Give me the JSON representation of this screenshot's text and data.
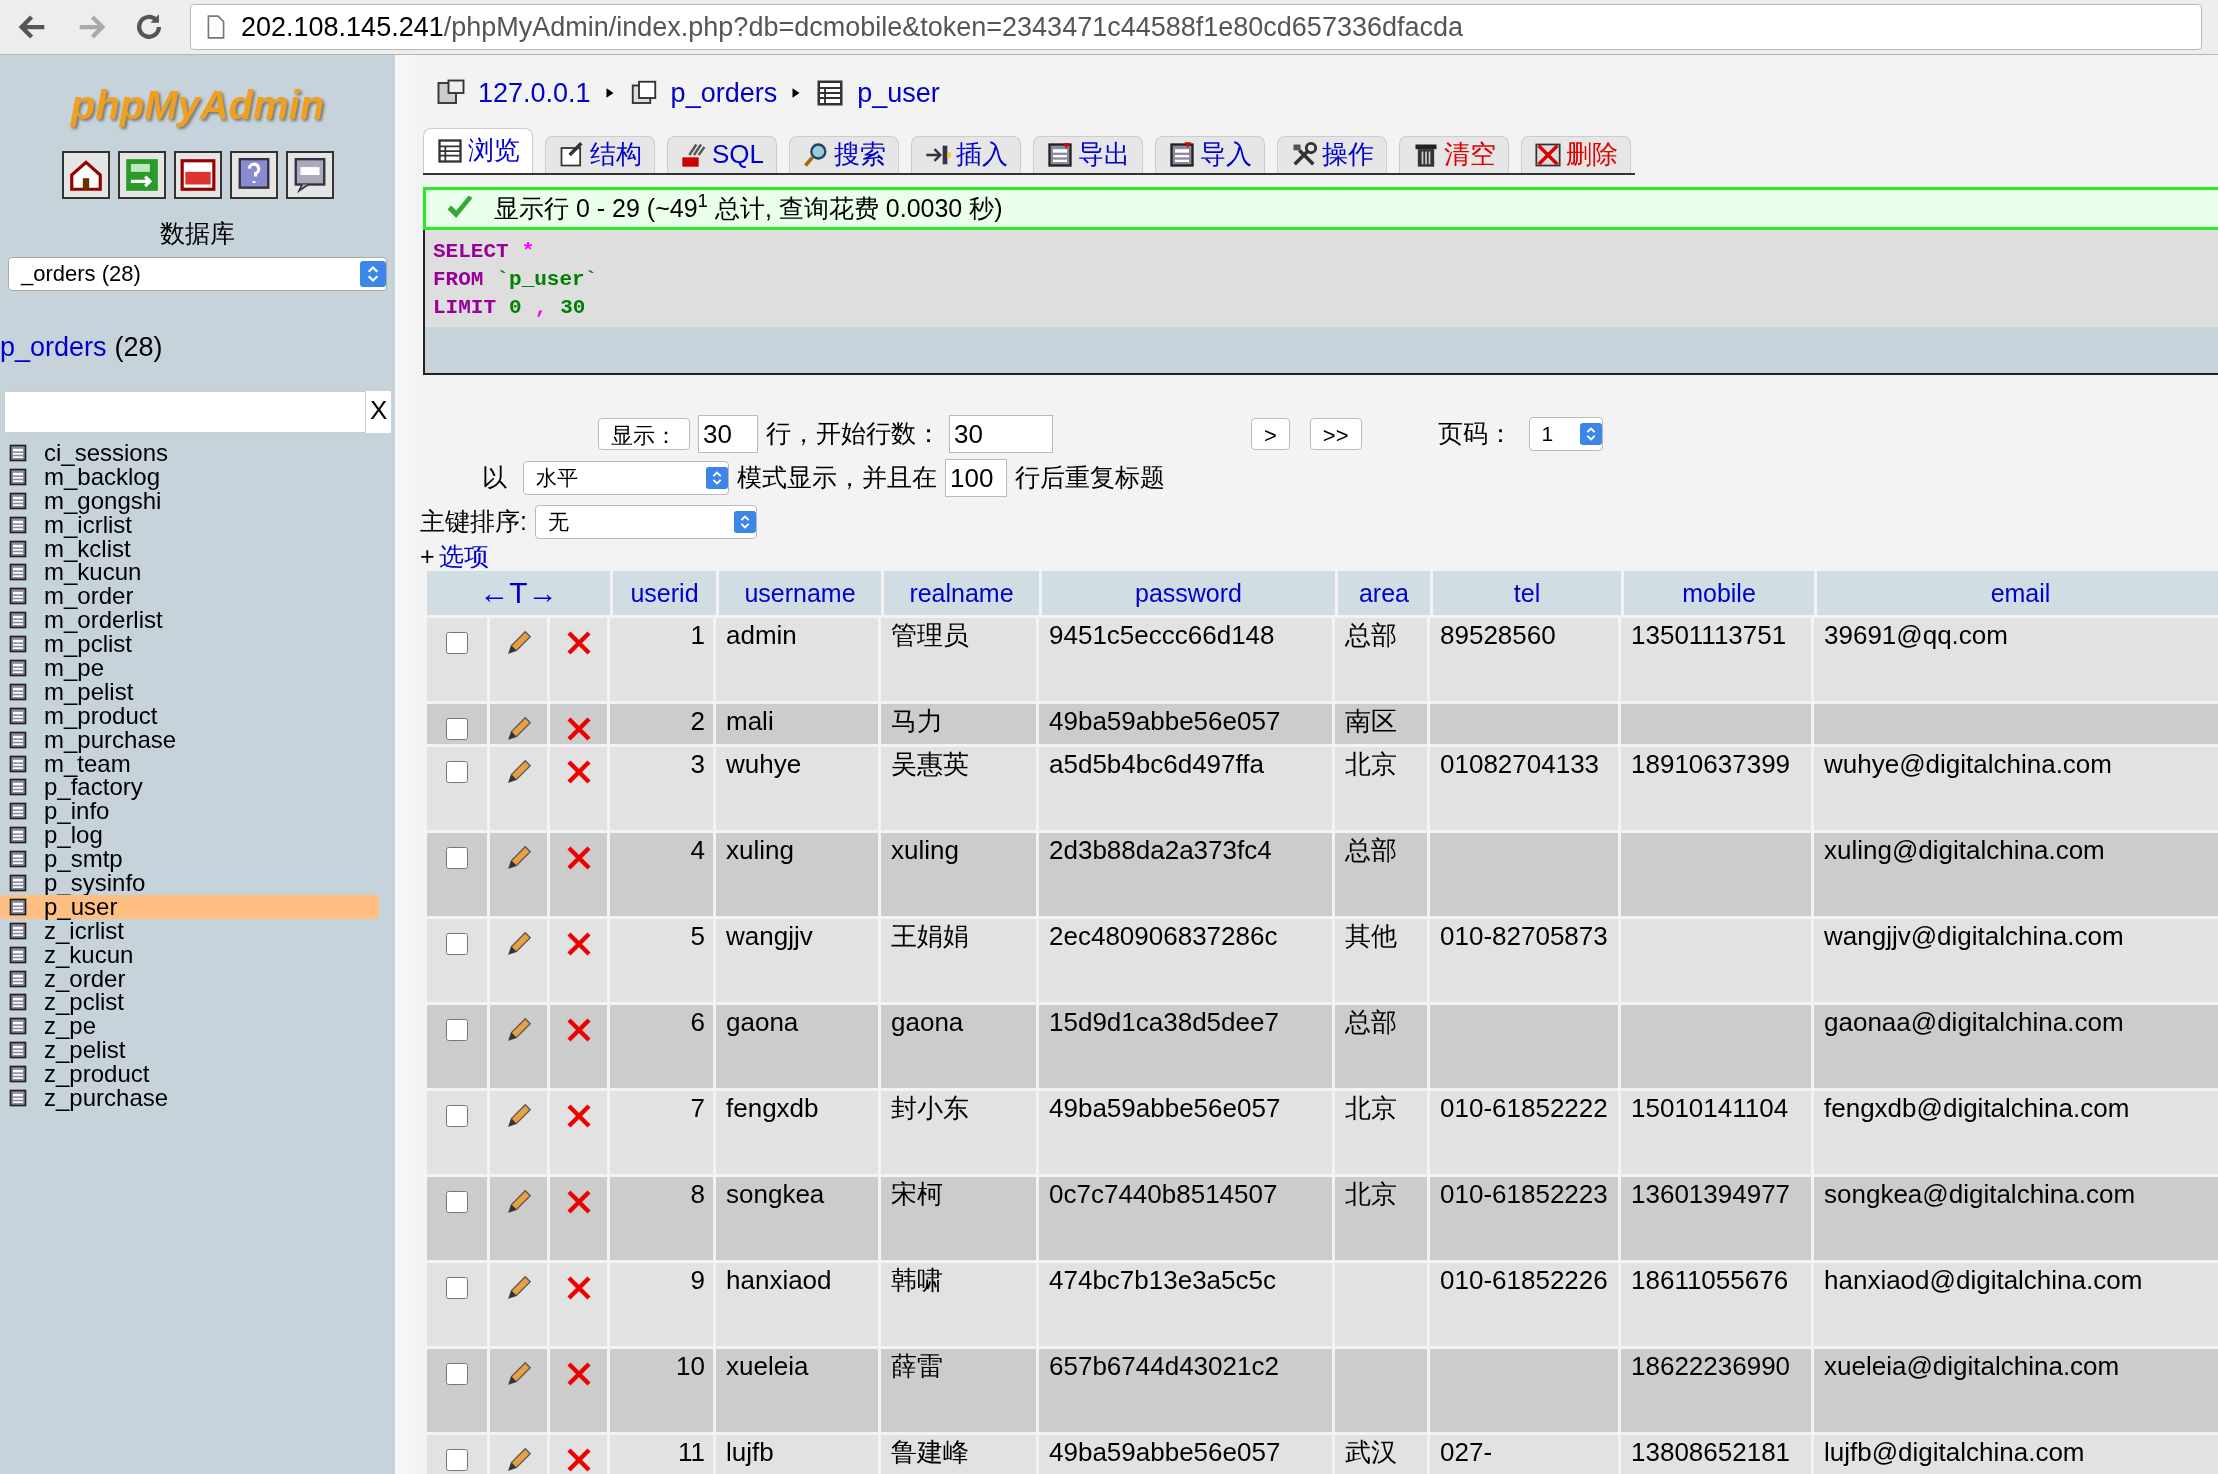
{
  "browser": {
    "url_host": "202.108.145.241",
    "url_path": "/phpMyAdmin/index.php?db=dcmobile&token=2343471c44588f1e80cd657336dfacda"
  },
  "sidebar": {
    "logo": "phpMyAdmin",
    "database_label": "数据库",
    "database_select": "_orders (28)",
    "database_link": "p_orders",
    "database_count": "(28)",
    "filter_clear": "X",
    "tables": [
      {
        "name": "ci_sessions",
        "selected": false
      },
      {
        "name": "m_backlog",
        "selected": false
      },
      {
        "name": "m_gongshi",
        "selected": false
      },
      {
        "name": "m_icrlist",
        "selected": false
      },
      {
        "name": "m_kclist",
        "selected": false
      },
      {
        "name": "m_kucun",
        "selected": false
      },
      {
        "name": "m_order",
        "selected": false
      },
      {
        "name": "m_orderlist",
        "selected": false
      },
      {
        "name": "m_pclist",
        "selected": false
      },
      {
        "name": "m_pe",
        "selected": false
      },
      {
        "name": "m_pelist",
        "selected": false
      },
      {
        "name": "m_product",
        "selected": false
      },
      {
        "name": "m_purchase",
        "selected": false
      },
      {
        "name": "m_team",
        "selected": false
      },
      {
        "name": "p_factory",
        "selected": false
      },
      {
        "name": "p_info",
        "selected": false
      },
      {
        "name": "p_log",
        "selected": false
      },
      {
        "name": "p_smtp",
        "selected": false
      },
      {
        "name": "p_sysinfo",
        "selected": false
      },
      {
        "name": "p_user",
        "selected": true
      },
      {
        "name": "z_icrlist",
        "selected": false
      },
      {
        "name": "z_kucun",
        "selected": false
      },
      {
        "name": "z_order",
        "selected": false
      },
      {
        "name": "z_pclist",
        "selected": false
      },
      {
        "name": "z_pe",
        "selected": false
      },
      {
        "name": "z_pelist",
        "selected": false
      },
      {
        "name": "z_product",
        "selected": false
      },
      {
        "name": "z_purchase",
        "selected": false
      }
    ]
  },
  "breadcrumb": [
    "127.0.0.1",
    "p_orders",
    "p_user"
  ],
  "tabs": [
    {
      "label": "浏览",
      "selected": true,
      "kind": "normal"
    },
    {
      "label": "结构",
      "selected": false,
      "kind": "normal"
    },
    {
      "label": "SQL",
      "selected": false,
      "kind": "normal"
    },
    {
      "label": "搜索",
      "selected": false,
      "kind": "normal"
    },
    {
      "label": "插入",
      "selected": false,
      "kind": "normal"
    },
    {
      "label": "导出",
      "selected": false,
      "kind": "normal"
    },
    {
      "label": "导入",
      "selected": false,
      "kind": "normal"
    },
    {
      "label": "操作",
      "selected": false,
      "kind": "normal"
    },
    {
      "label": "清空",
      "selected": false,
      "kind": "danger"
    },
    {
      "label": "删除",
      "selected": false,
      "kind": "danger"
    }
  ],
  "message": "显示行 0 - 29 (~49$^{1}$ 总计, 查询花费 0.0030 秒)",
  "sql": [
    [
      {
        "text": "SELECT",
        "kind": "keyword"
      },
      {
        "text": "*",
        "kind": "operator"
      }
    ],
    [
      {
        "text": "FROM",
        "kind": "keyword"
      },
      {
        "text": "`p_user`",
        "kind": "identifier"
      }
    ],
    [
      {
        "text": "LIMIT",
        "kind": "keyword"
      },
      {
        "text": "0",
        "kind": "number"
      },
      {
        "text": ",",
        "kind": "operator"
      },
      {
        "text": "30",
        "kind": "number"
      }
    ]
  ],
  "navigation": {
    "show_button": "显示：",
    "rows_value": "30",
    "rows_label": "行，开始行数：",
    "start_value": "30",
    "next_button": ">",
    "last_button": ">>",
    "page_label": "页码：",
    "page_select": "1",
    "mode_prefix": "以",
    "mode_select": "水平",
    "mode_label": "模式显示，并且在",
    "repeat_value": "100",
    "repeat_label": "行后重复标题",
    "sort_label": "主键排序:",
    "sort_select": "无",
    "options_plus": "+",
    "options_link": "选项"
  },
  "table": {
    "column_toggle": "←T→",
    "columns": [
      "userid",
      "username",
      "realname",
      "password",
      "area",
      "tel",
      "mobile",
      "email"
    ],
    "rows": [
      {
        "checked": false,
        "cells": [
          "1",
          "admin",
          "管理员",
          "9451c5eccc66d148",
          "总部",
          "89528560",
          "13501113751",
          "39691@qq.com"
        ]
      },
      {
        "checked": false,
        "cells": [
          "2",
          "mali",
          "马力",
          "49ba59abbe56e057",
          "南区",
          "",
          "",
          ""
        ]
      },
      {
        "checked": false,
        "cells": [
          "3",
          "wuhye",
          "吴惠英",
          "a5d5b4bc6d497ffa",
          "北京",
          "01082704133",
          "18910637399",
          "wuhye@digitalchina.com"
        ]
      },
      {
        "checked": false,
        "cells": [
          "4",
          "xuling",
          "xuling",
          "2d3b88da2a373fc4",
          "总部",
          "",
          "",
          "xuling@digitalchina.com"
        ]
      },
      {
        "checked": false,
        "cells": [
          "5",
          "wangjjv",
          "王娟娟",
          "2ec480906837286c",
          "其他",
          "010-82705873",
          "",
          "wangjjv@digitalchina.com"
        ]
      },
      {
        "checked": false,
        "cells": [
          "6",
          "gaona",
          "gaona",
          "15d9d1ca38d5dee7",
          "总部",
          "",
          "",
          "gaonaa@digitalchina.com"
        ]
      },
      {
        "checked": false,
        "cells": [
          "7",
          "fengxdb",
          "封小东",
          "49ba59abbe56e057",
          "北京",
          "010-61852222",
          "15010141104",
          "fengxdb@digitalchina.com"
        ]
      },
      {
        "checked": false,
        "cells": [
          "8",
          "songkea",
          "宋柯",
          "0c7c7440b8514507",
          "北京",
          "010-61852223",
          "13601394977",
          "songkea@digitalchina.com"
        ]
      },
      {
        "checked": false,
        "cells": [
          "9",
          "hanxiaod",
          "韩啸",
          "474bc7b13e3a5c5c",
          "",
          "010-61852226",
          "18611055676",
          "hanxiaod@digitalchina.com"
        ]
      },
      {
        "checked": false,
        "cells": [
          "10",
          "xueleia",
          "薛雷",
          "657b6744d43021c2",
          "",
          "",
          "18622236990",
          "xueleia@digitalchina.com"
        ]
      },
      {
        "checked": false,
        "cells": [
          "11",
          "lujfb",
          "鲁建峰",
          "49ba59abbe56e057",
          "武汉",
          "027-",
          "13808652181",
          "lujfb@digitalchina.com"
        ]
      }
    ]
  }
}
